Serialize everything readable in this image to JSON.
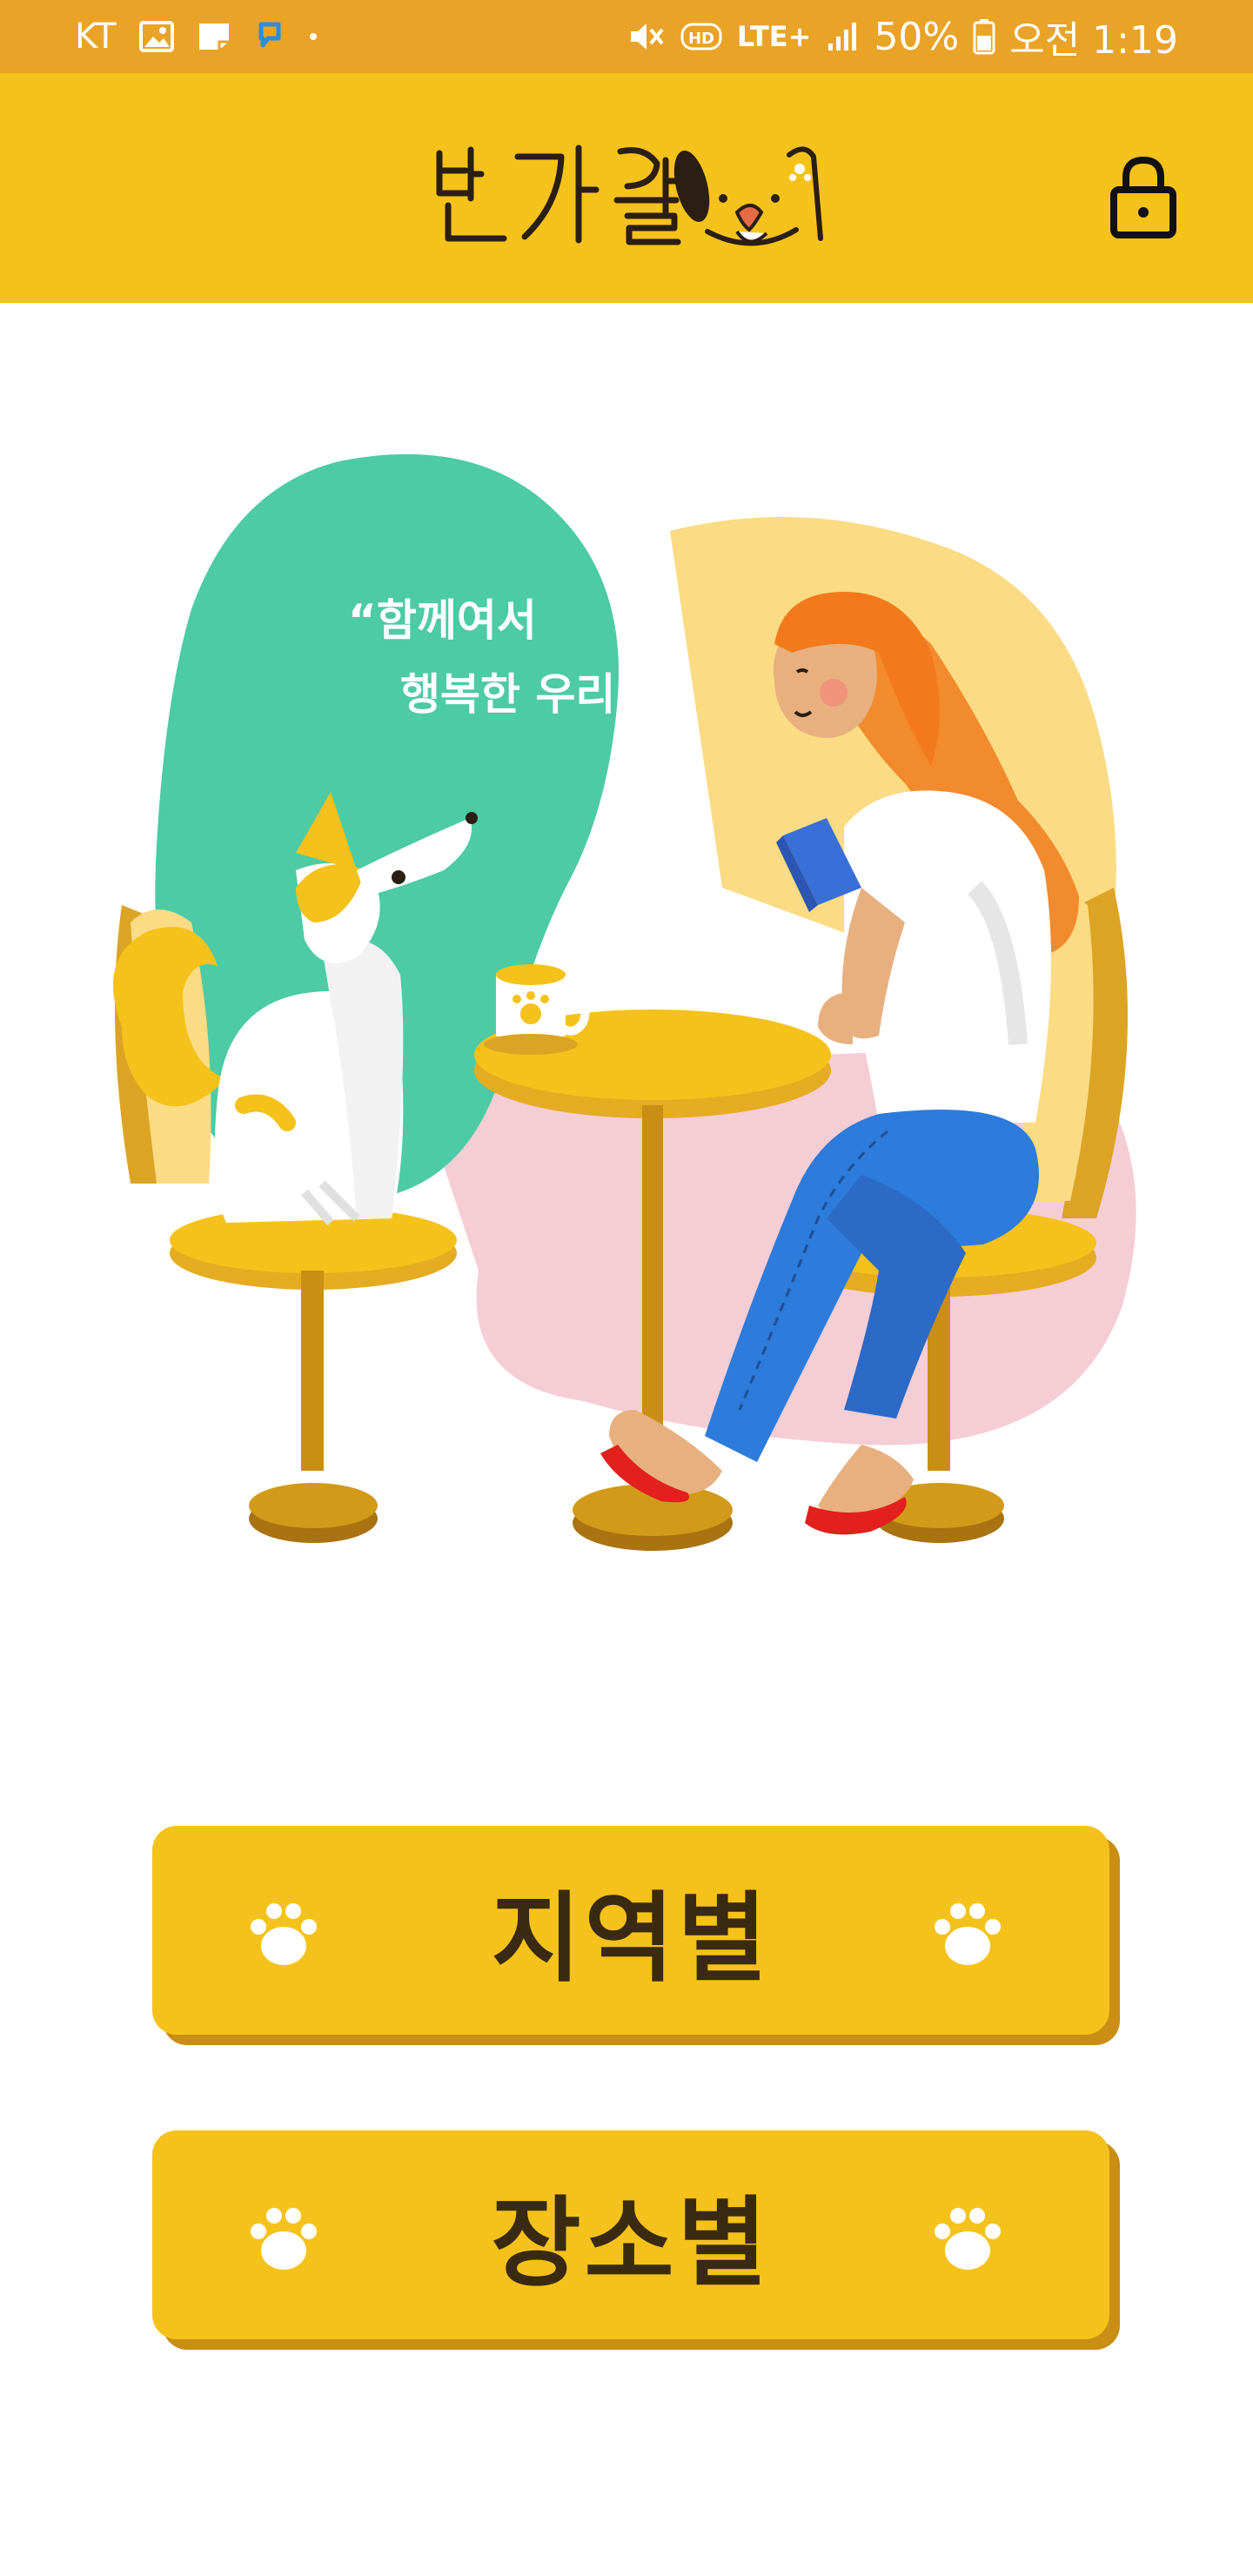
{
  "status_bar": {
    "carrier": "KT",
    "network": "LTE+",
    "hd": "HD",
    "battery": "50%",
    "time": "오전 1:19"
  },
  "header": {
    "logo_text": "반가월",
    "lock_icon": "lock-icon",
    "color": "#F5C21B"
  },
  "illustration": {
    "speech_line1": "“함께여서",
    "speech_line2": "행복한 우리”"
  },
  "buttons": [
    {
      "label": "지역별",
      "icon": "paw-icon"
    },
    {
      "label": "장소별",
      "icon": "paw-icon"
    }
  ],
  "colors": {
    "status_bar": "#E9A326",
    "accent": "#F5C21B",
    "button_shadow": "#C98E13",
    "button_text": "#3A2A12"
  }
}
